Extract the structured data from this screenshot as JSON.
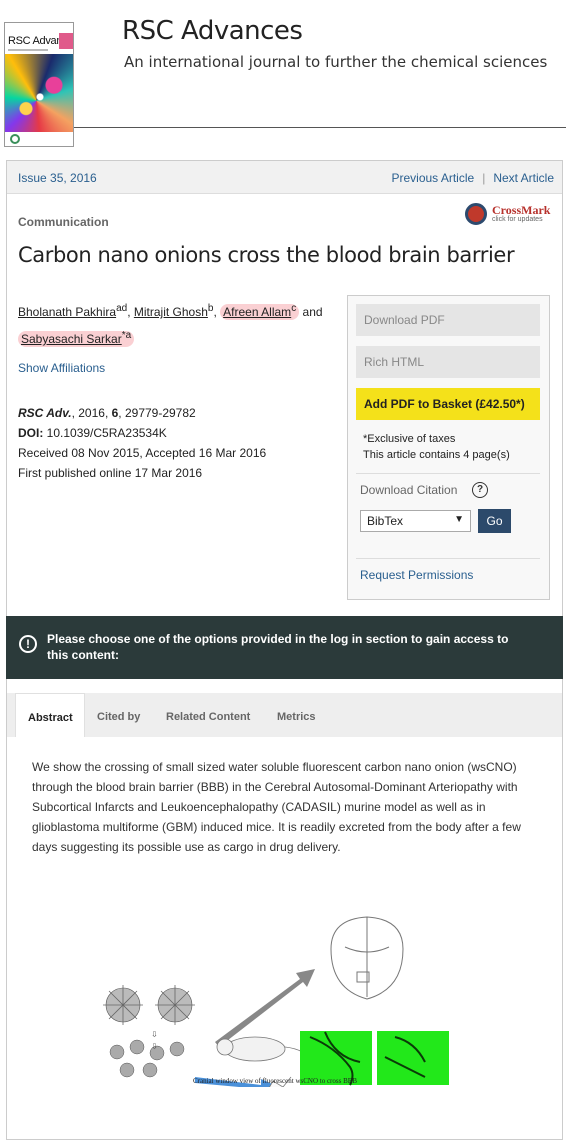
{
  "header": {
    "cover_title": "RSC Advances",
    "journal_title": "RSC Advances",
    "journal_subtitle": "An international journal to further the chemical sciences"
  },
  "nav": {
    "issue": "Issue 35, 2016",
    "previous": "Previous Article",
    "separator": "|",
    "next": "Next Article"
  },
  "article": {
    "type": "Communication",
    "crossmark_name": "CrossMark",
    "crossmark_sub": "click for updates",
    "title": "Carbon nano onions cross the blood brain barrier",
    "authors": [
      {
        "name": "Bholanath Pakhira",
        "sup": "ad",
        "after": ", "
      },
      {
        "name": "Mitrajit Ghosh",
        "sup": "b",
        "after": ", "
      },
      {
        "name": "Afreen Allam",
        "sup": "c",
        "after": " and "
      },
      {
        "name": "Sabyasachi Sarkar",
        "sup": "*a",
        "after": ""
      }
    ],
    "show_affiliations": "Show Affiliations",
    "journal_abbrev": "RSC Adv.",
    "citation_rest": ", 2016, ",
    "volume": "6",
    "pages": ", 29779-29782",
    "doi_label": "DOI:",
    "doi": " 10.1039/C5RA23534K",
    "received": "Received 08 Nov 2015, Accepted 16 Mar 2016",
    "published": "First published online 17 Mar 2016"
  },
  "sidebar": {
    "download_pdf": "Download PDF",
    "rich_html": "Rich HTML",
    "basket": "Add PDF to Basket (£42.50*)",
    "exclusive": "*Exclusive of taxes",
    "pages_note": "This article contains 4 page(s)",
    "download_citation": "Download Citation",
    "help": "?",
    "citation_format": "BibTex",
    "go": "Go",
    "request_permissions": "Request Permissions"
  },
  "banner": {
    "icon": "!",
    "message": "Please choose one of the options provided in the log in section to gain access to this content:"
  },
  "tabs": [
    "Abstract",
    "Cited by",
    "Related Content",
    "Metrics"
  ],
  "abstract": "We show the crossing of small sized water soluble fluorescent carbon nano onion (wsCNO) through the blood brain barrier (BBB) in the Cerebral Autosomal-Dominant Arteriopathy with Subcortical Infarcts and Leukoencephalopathy (CADASIL) murine model as well as in glioblastoma multiforme (GBM) induced mice. It is readily excreted from the body after a few days suggesting its possible use as cargo in drug delivery.",
  "figure": {
    "caption": "Cranial  window view of fluorescent  wsCNO  to  cross  BBB"
  },
  "colors": {
    "link": "#2a5f8f",
    "basket": "#f4e11a",
    "banner": "#2b3a3a",
    "go_button": "#2c4a6b",
    "highlight": "#f07882"
  }
}
